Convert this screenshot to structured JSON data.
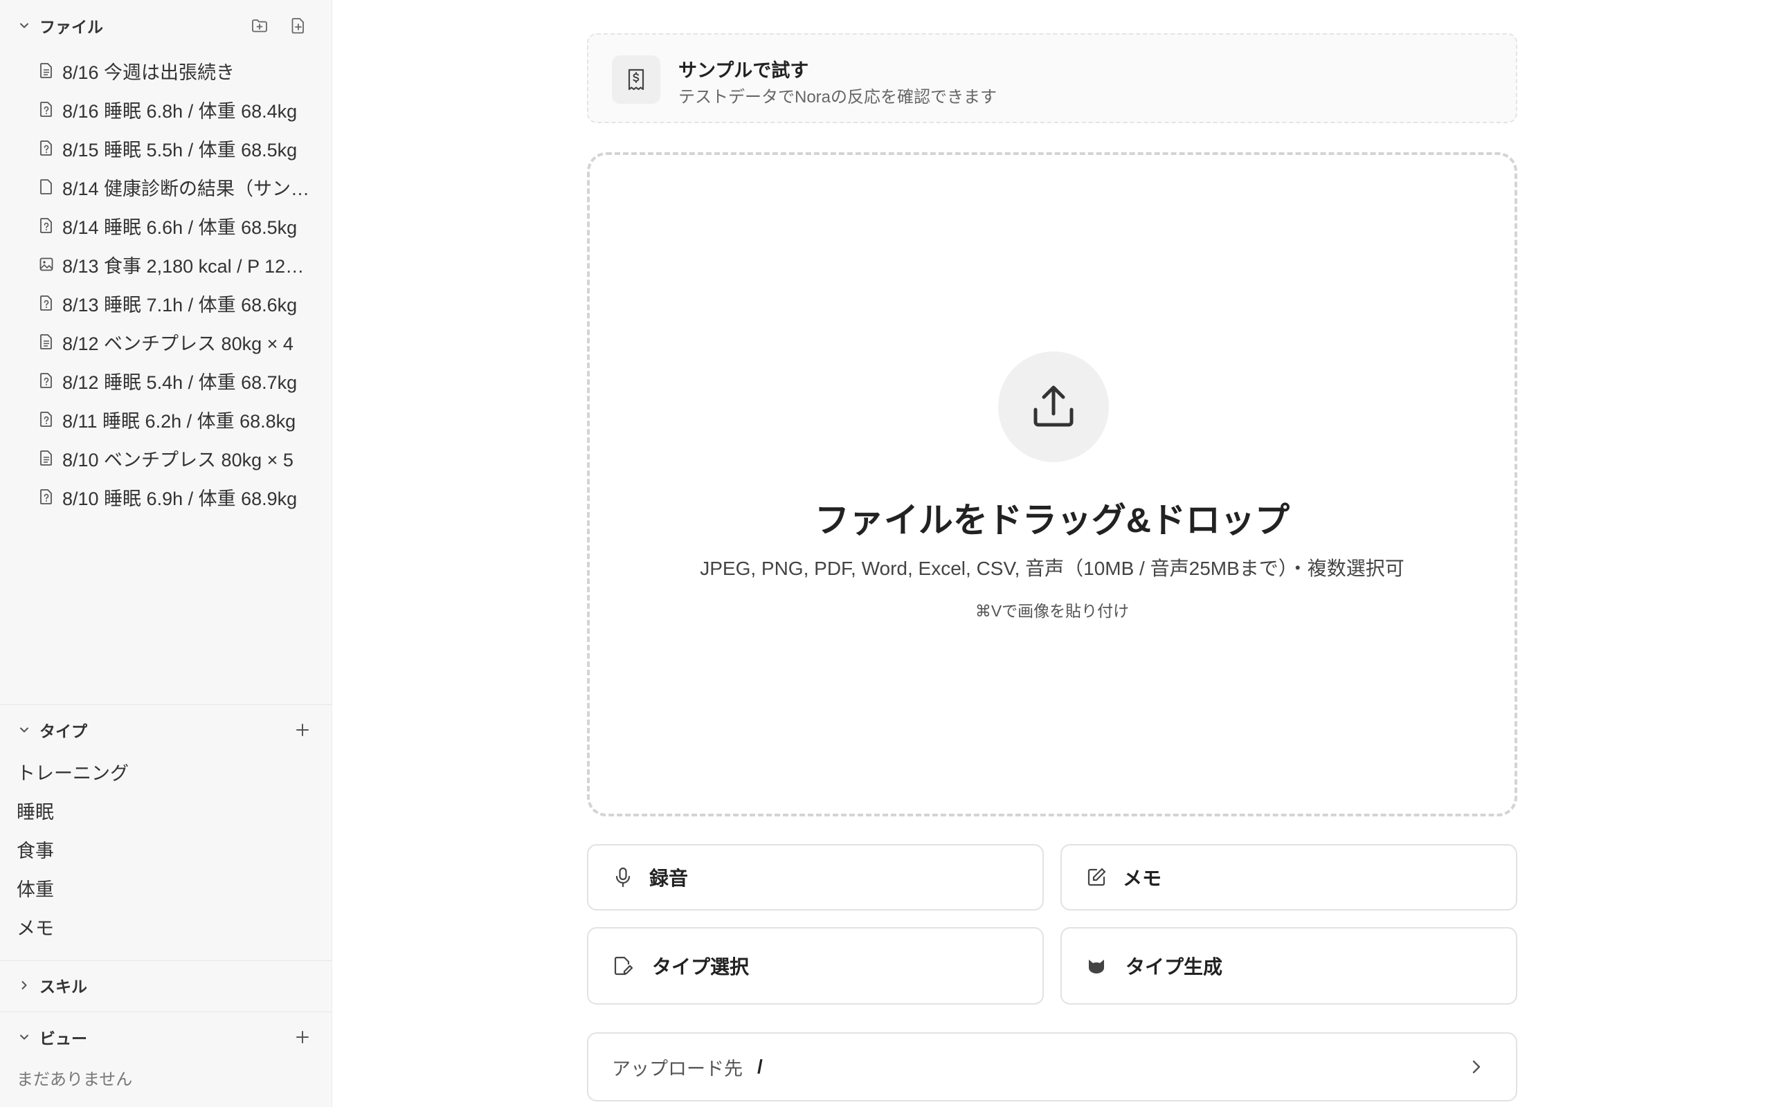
{
  "sidebar": {
    "files_section": {
      "title": "ファイル",
      "items": [
        {
          "label": "8/16 今週は出張続き",
          "icon": "document-icon"
        },
        {
          "label": "8/16 睡眠 6.8h / 体重 68.4kg",
          "icon": "unknown-file-icon"
        },
        {
          "label": "8/15 睡眠 5.5h / 体重 68.5kg",
          "icon": "unknown-file-icon"
        },
        {
          "label": "8/14 健康診断の結果（サン…",
          "icon": "file-icon"
        },
        {
          "label": "8/14 睡眠 6.6h / 体重 68.5kg",
          "icon": "unknown-file-icon"
        },
        {
          "label": "8/13 食事 2,180 kcal / P 12…",
          "icon": "image-icon"
        },
        {
          "label": "8/13 睡眠 7.1h / 体重 68.6kg",
          "icon": "unknown-file-icon"
        },
        {
          "label": "8/12 ベンチプレス 80kg × 4",
          "icon": "document-icon"
        },
        {
          "label": "8/12 睡眠 5.4h / 体重 68.7kg",
          "icon": "unknown-file-icon"
        },
        {
          "label": "8/11 睡眠 6.2h / 体重 68.8kg",
          "icon": "unknown-file-icon"
        },
        {
          "label": "8/10 ベンチプレス 80kg × 5",
          "icon": "document-icon"
        },
        {
          "label": "8/10 睡眠 6.9h / 体重 68.9kg",
          "icon": "unknown-file-icon"
        }
      ]
    },
    "types_section": {
      "title": "タイプ",
      "items": [
        "トレーニング",
        "睡眠",
        "食事",
        "体重",
        "メモ"
      ]
    },
    "skills_section": {
      "title": "スキル"
    },
    "views_section": {
      "title": "ビュー",
      "empty": "まだありません"
    }
  },
  "main": {
    "sample": {
      "title": "サンプルで試す",
      "subtitle": "テストデータでNoraの反応を確認できます"
    },
    "dropzone": {
      "title": "ファイルをドラッグ&ドロップ",
      "formats": "JPEG, PNG, PDF, Word, Excel, CSV, 音声（10MB / 音声25MBまで）・複数選択可",
      "hint": "⌘Vで画像を貼り付け"
    },
    "actions": {
      "record": "録音",
      "memo": "メモ",
      "type_select": "タイプ選択",
      "type_generate": "タイプ生成"
    },
    "destination": {
      "label": "アップロード先",
      "path": "/"
    }
  },
  "colors": {
    "sidebar_bg": "#f7f7f7",
    "text": "#222222",
    "border": "#e2e2e2",
    "dashed": "#d4d4d4"
  }
}
